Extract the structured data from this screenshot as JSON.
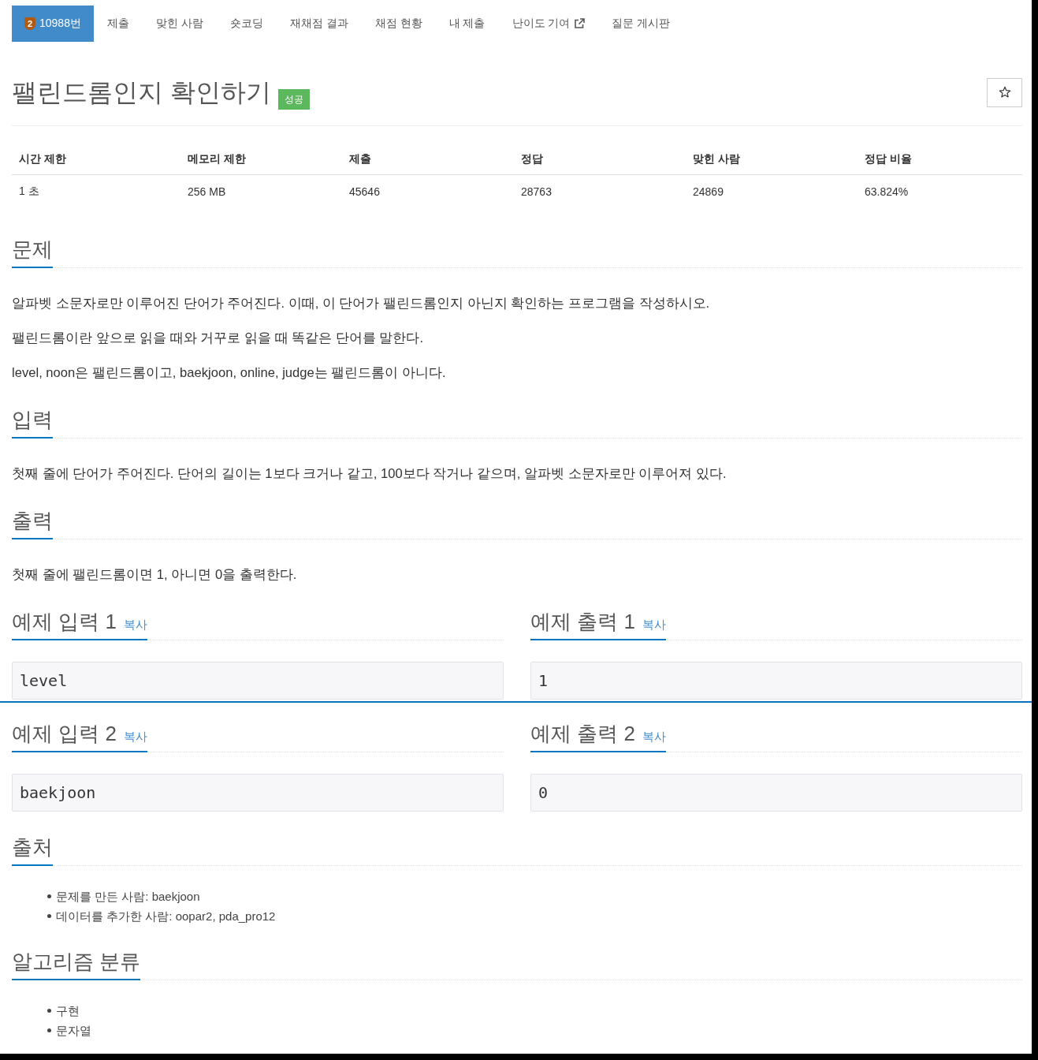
{
  "nav": {
    "tabs": [
      {
        "label": "10988번",
        "tier": "2",
        "selected": true,
        "external": false
      },
      {
        "label": "제출",
        "selected": false,
        "external": false
      },
      {
        "label": "맞힌 사람",
        "selected": false,
        "external": false
      },
      {
        "label": "숏코딩",
        "selected": false,
        "external": false
      },
      {
        "label": "재채점 결과",
        "selected": false,
        "external": false
      },
      {
        "label": "채점 현황",
        "selected": false,
        "external": false
      },
      {
        "label": "내 제출",
        "selected": false,
        "external": false
      },
      {
        "label": "난이도 기여",
        "selected": false,
        "external": true
      },
      {
        "label": "질문 게시판",
        "selected": false,
        "external": false
      }
    ]
  },
  "problem": {
    "title": "팰린드롬인지 확인하기",
    "result": "성공",
    "starred": false
  },
  "limits": {
    "columns": [
      "시간 제한",
      "메모리 제한",
      "제출",
      "정답",
      "맞힌 사람",
      "정답 비율"
    ],
    "rows": [
      [
        "1 초",
        "256 MB",
        "45646",
        "28763",
        "24869",
        "63.824%"
      ]
    ]
  },
  "sections": [
    {
      "kind": "text",
      "heading": "문제",
      "paragraphs": [
        "알파벳 소문자로만 이루어진 단어가 주어진다. 이때, 이 단어가 팰린드롬인지 아닌지 확인하는 프로그램을 작성하시오.",
        "팰린드롬이란 앞으로 읽을 때와 거꾸로 읽을 때 똑같은 단어를 말한다.",
        "level, noon은 팰린드롬이고, baekjoon, online, judge는 팰린드롬이 아니다."
      ]
    },
    {
      "kind": "text",
      "heading": "입력",
      "paragraphs": [
        "첫째 줄에 단어가 주어진다. 단어의 길이는 1보다 크거나 같고, 100보다 작거나 같으며, 알파벳 소문자로만 이루어져 있다."
      ]
    },
    {
      "kind": "text",
      "heading": "출력",
      "paragraphs": [
        "첫째 줄에 팰린드롬이면 1, 아니면 0을 출력한다."
      ]
    },
    {
      "kind": "examples",
      "rows": [
        {
          "input_heading": "예제 입력 1",
          "input_copy": "복사",
          "input": "level",
          "output_heading": "예제 출력 1",
          "output_copy": "복사",
          "output": "1"
        },
        {
          "input_heading": "예제 입력 2",
          "input_copy": "복사",
          "input": "baekjoon",
          "output_heading": "예제 출력 2",
          "output_copy": "복사",
          "output": "0"
        }
      ]
    },
    {
      "kind": "list",
      "heading": "출처",
      "items": [
        "문제를 만든 사람: baekjoon",
        "데이터를 추가한 사람: oopar2, pda_pro12"
      ]
    },
    {
      "kind": "list",
      "heading": "알고리즘 분류",
      "items": [
        "구현",
        "문자열"
      ]
    }
  ]
}
